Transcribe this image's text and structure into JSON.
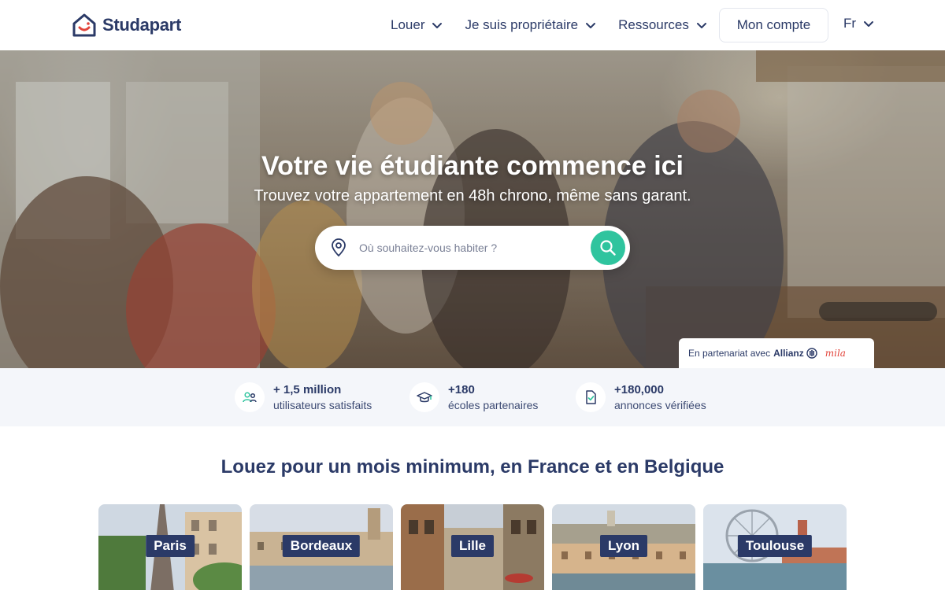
{
  "header": {
    "logo_text": "Studapart",
    "nav": [
      {
        "label": "Louer"
      },
      {
        "label": "Je suis propriétaire"
      },
      {
        "label": "Ressources"
      }
    ],
    "account_label": "Mon compte",
    "language": "Fr"
  },
  "hero": {
    "title": "Votre vie étudiante commence ici",
    "subtitle": "Trouvez votre appartement en 48h chrono, même sans garant.",
    "search_placeholder": "Où souhaitez-vous habiter ?",
    "partner_prefix": "En partenariat avec",
    "partner_allianz": "Allianz",
    "partner_mila": "mila"
  },
  "stats": [
    {
      "value": "+ 1,5 million",
      "label": "utilisateurs satisfaits",
      "icon": "users-icon"
    },
    {
      "value": "+180",
      "label": "écoles partenaires",
      "icon": "graduation-cap-icon"
    },
    {
      "value": "+180,000",
      "label": "annonces vérifiées",
      "icon": "verified-document-icon"
    }
  ],
  "cities_section": {
    "title": "Louez pour un mois minimum, en France et en Belgique",
    "cities": [
      {
        "name": "Paris"
      },
      {
        "name": "Bordeaux"
      },
      {
        "name": "Lille"
      },
      {
        "name": "Lyon"
      },
      {
        "name": "Toulouse"
      }
    ]
  },
  "colors": {
    "brand_navy": "#2b3a67",
    "accent_green": "#2fc49e",
    "logo_red": "#e2453c",
    "stats_bg": "#f4f6fa"
  }
}
